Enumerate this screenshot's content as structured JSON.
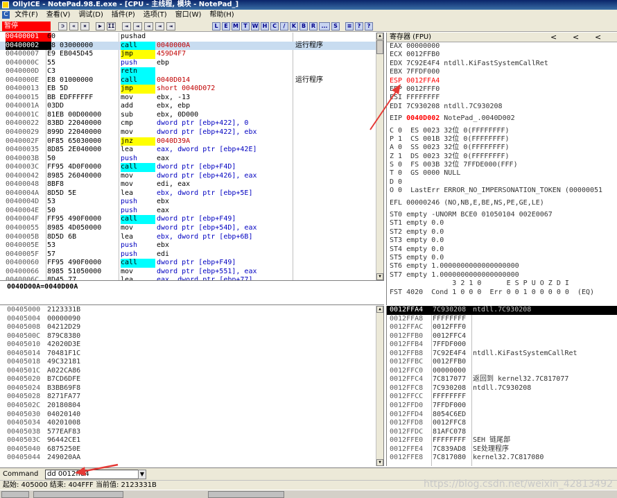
{
  "window": {
    "title": "OllyICE - NotePad.98.E.exe - [CPU - 主线程, 模块 - NotePad_]"
  },
  "menu": [
    "文件(F)",
    "查看(V)",
    "调试(D)",
    "插件(P)",
    "选项(T)",
    "窗口(W)",
    "帮助(H)"
  ],
  "toolbar": {
    "status": "暂停",
    "buttons": [
      "⊃",
      "«",
      "×",
      "▶",
      "II",
      "⇥",
      "⇥",
      "⇥",
      "⇥",
      "⇥"
    ],
    "letters": [
      "L",
      "E",
      "M",
      "T",
      "W",
      "H",
      "C",
      "/",
      "K",
      "B",
      "R",
      "...",
      "S",
      "≡",
      "?",
      "?"
    ]
  },
  "cpu": {
    "rows": [
      {
        "addr": "00400001",
        "hex": "60",
        "mn": "pushad",
        "ops": "",
        "cm": "",
        "addr_red": true
      },
      {
        "addr": "00400002",
        "hex": "E8 03000000",
        "mn": "call",
        "ops": "0040000A",
        "cm": "运行程序",
        "sel": true
      },
      {
        "addr": "00400007",
        "hex": "E9 EB045D45",
        "mn": "jmp",
        "ops": "459D4F7",
        "cm": ""
      },
      {
        "addr": "0040000C",
        "hex": "55",
        "mn": "push",
        "ops": "ebp",
        "cm": ""
      },
      {
        "addr": "0040000D",
        "hex": "C3",
        "mn": "retn",
        "ops": "",
        "cm": ""
      },
      {
        "addr": "0040000E",
        "hex": "E8 01000000",
        "mn": "call",
        "ops": "0040D014",
        "cm": "运行程序"
      },
      {
        "addr": "00400013",
        "hex": "EB 5D",
        "mn": "jmp",
        "ops": "short 0040D072",
        "cm": ""
      },
      {
        "addr": "00400015",
        "hex": "BB EDFFFFFF",
        "mn": "mov",
        "ops": "ebx, -13",
        "cm": ""
      },
      {
        "addr": "0040001A",
        "hex": "03DD",
        "mn": "add",
        "ops": "ebx, ebp",
        "cm": ""
      },
      {
        "addr": "0040001C",
        "hex": "81EB 00D00000",
        "mn": "sub",
        "ops": "ebx, 0D000",
        "cm": ""
      },
      {
        "addr": "00400022",
        "hex": "83BD 22040000",
        "mn": "cmp",
        "ops": "dword ptr [ebp+422], 0",
        "cm": ""
      },
      {
        "addr": "00400029",
        "hex": "899D 22040000",
        "mn": "mov",
        "ops": "dword ptr [ebp+422], ebx",
        "cm": ""
      },
      {
        "addr": "0040002F",
        "hex": "0F85 65030000",
        "mn": "jnz",
        "ops": "0040D39A",
        "cm": ""
      },
      {
        "addr": "00400035",
        "hex": "8D85 2E040000",
        "mn": "lea",
        "ops": "eax, dword ptr [ebp+42E]",
        "cm": ""
      },
      {
        "addr": "0040003B",
        "hex": "50",
        "mn": "push",
        "ops": "eax",
        "cm": ""
      },
      {
        "addr": "0040003C",
        "hex": "FF95 4D0F0000",
        "mn": "call",
        "ops": "dword ptr [ebp+F4D]",
        "cm": ""
      },
      {
        "addr": "00400042",
        "hex": "8985 26040000",
        "mn": "mov",
        "ops": "dword ptr [ebp+426], eax",
        "cm": ""
      },
      {
        "addr": "00400048",
        "hex": "8BF8",
        "mn": "mov",
        "ops": "edi, eax",
        "cm": ""
      },
      {
        "addr": "0040004A",
        "hex": "8D5D 5E",
        "mn": "lea",
        "ops": "ebx, dword ptr [ebp+5E]",
        "cm": ""
      },
      {
        "addr": "0040004D",
        "hex": "53",
        "mn": "push",
        "ops": "ebx",
        "cm": ""
      },
      {
        "addr": "0040004E",
        "hex": "50",
        "mn": "push",
        "ops": "eax",
        "cm": ""
      },
      {
        "addr": "0040004F",
        "hex": "FF95 490F0000",
        "mn": "call",
        "ops": "dword ptr [ebp+F49]",
        "cm": ""
      },
      {
        "addr": "00400055",
        "hex": "8985 4D050000",
        "mn": "mov",
        "ops": "dword ptr [ebp+54D], eax",
        "cm": ""
      },
      {
        "addr": "0040005B",
        "hex": "8D5D 6B",
        "mn": "lea",
        "ops": "ebx, dword ptr [ebp+6B]",
        "cm": ""
      },
      {
        "addr": "0040005E",
        "hex": "53",
        "mn": "push",
        "ops": "ebx",
        "cm": ""
      },
      {
        "addr": "0040005F",
        "hex": "57",
        "mn": "push",
        "ops": "edi",
        "cm": ""
      },
      {
        "addr": "00400060",
        "hex": "FF95 490F0000",
        "mn": "call",
        "ops": "dword ptr [ebp+F49]",
        "cm": ""
      },
      {
        "addr": "00400066",
        "hex": "8985 51050000",
        "mn": "mov",
        "ops": "dword ptr [ebp+551], eax",
        "cm": ""
      },
      {
        "addr": "0040006C",
        "hex": "8D45 77",
        "mn": "lea",
        "ops": "eax, dword ptr [ebp+77]",
        "cm": ""
      }
    ]
  },
  "info": {
    "text": "0040D00A=0040D00A"
  },
  "registers": {
    "header": "寄存器 (FPU)",
    "nav": [
      "<",
      "<",
      "<"
    ],
    "lines": [
      {
        "t": "EAX 00000000"
      },
      {
        "t": "ECX 0012FFB0"
      },
      {
        "t": "EDX 7C92E4F4 ntdll.KiFastSystemCallRet"
      },
      {
        "t": "EBX 7FFDF000"
      },
      {
        "t": "ESP 0012FFA4",
        "red": true
      },
      {
        "t": "EBP 0012FFF0"
      },
      {
        "t": "ESI FFFFFFFF"
      },
      {
        "t": "EDI 7C930208 ntdll.7C930208"
      },
      {
        "gap": true
      },
      {
        "t": "EIP 0040D002 NotePad_.0040D002",
        "eip": true
      },
      {
        "gap": true
      },
      {
        "t": "C 0  ES 0023 32位 0(FFFFFFFF)"
      },
      {
        "t": "P 1  CS 001B 32位 0(FFFFFFFF)"
      },
      {
        "t": "A 0  SS 0023 32位 0(FFFFFFFF)"
      },
      {
        "t": "Z 1  DS 0023 32位 0(FFFFFFFF)"
      },
      {
        "t": "S 0  FS 003B 32位 7FFDE000(FFF)"
      },
      {
        "t": "T 0  GS 0000 NULL"
      },
      {
        "t": "D 0"
      },
      {
        "t": "O 0  LastErr ERROR_NO_IMPERSONATION_TOKEN (00000051"
      },
      {
        "gap": true
      },
      {
        "t": "EFL 00000246 (NO,NB,E,BE,NS,PE,GE,LE)"
      },
      {
        "gap": true
      },
      {
        "t": "ST0 empty -UNORM BCE0 01050104 002E0067"
      },
      {
        "t": "ST1 empty 0.0"
      },
      {
        "t": "ST2 empty 0.0"
      },
      {
        "t": "ST3 empty 0.0"
      },
      {
        "t": "ST4 empty 0.0"
      },
      {
        "t": "ST5 empty 0.0"
      },
      {
        "t": "ST6 empty 1.0000000000000000000"
      },
      {
        "t": "ST7 empty 1.0000000000000000000"
      },
      {
        "t": "               3 2 1 0      E S P U O Z D I"
      },
      {
        "t": "FST 4020  Cond 1 0 0 0  Err 0 0 1 0 0 0 0 0  (EQ)"
      }
    ]
  },
  "dump": {
    "rows": [
      {
        "addr": "00405000",
        "val": "2123331B"
      },
      {
        "addr": "00405004",
        "val": "00000090"
      },
      {
        "addr": "00405008",
        "val": "04212D29"
      },
      {
        "addr": "0040500C",
        "val": "879C8380"
      },
      {
        "addr": "00405010",
        "val": "42020D3E"
      },
      {
        "addr": "00405014",
        "val": "70481F1C"
      },
      {
        "addr": "00405018",
        "val": "49C32181"
      },
      {
        "addr": "0040501C",
        "val": "A022CA86"
      },
      {
        "addr": "00405020",
        "val": "B7CD6DFE"
      },
      {
        "addr": "00405024",
        "val": "B3BB69F8"
      },
      {
        "addr": "00405028",
        "val": "8271FA77"
      },
      {
        "addr": "0040502C",
        "val": "20180804"
      },
      {
        "addr": "00405030",
        "val": "04020140"
      },
      {
        "addr": "00405034",
        "val": "40201008"
      },
      {
        "addr": "00405038",
        "val": "577EAF83"
      },
      {
        "addr": "0040503C",
        "val": "96442CE1"
      },
      {
        "addr": "00405040",
        "val": "6875250E"
      },
      {
        "addr": "00405044",
        "val": "249020AA"
      }
    ]
  },
  "stack": {
    "rows": [
      {
        "addr": "0012FFA4",
        "val": "7C930208",
        "cm": "ntdll.7C930208",
        "sel": true
      },
      {
        "addr": "0012FFA8",
        "val": "FFFFFFFF",
        "cm": ""
      },
      {
        "addr": "0012FFAC",
        "val": "0012FFF0",
        "cm": ""
      },
      {
        "addr": "0012FFB0",
        "val": "0012FFC4",
        "cm": ""
      },
      {
        "addr": "0012FFB4",
        "val": "7FFDF000",
        "cm": ""
      },
      {
        "addr": "0012FFB8",
        "val": "7C92E4F4",
        "cm": "ntdll.KiFastSystemCallRet"
      },
      {
        "addr": "0012FFBC",
        "val": "0012FFB0",
        "cm": ""
      },
      {
        "addr": "0012FFC0",
        "val": "00000000",
        "cm": ""
      },
      {
        "addr": "0012FFC4",
        "val": "7C817077",
        "cm": "返回到 kernel32.7C817077"
      },
      {
        "addr": "0012FFC8",
        "val": "7C930208",
        "cm": "ntdll.7C930208"
      },
      {
        "addr": "0012FFCC",
        "val": "FFFFFFFF",
        "cm": ""
      },
      {
        "addr": "0012FFD0",
        "val": "7FFDF000",
        "cm": ""
      },
      {
        "addr": "0012FFD4",
        "val": "8054C6ED",
        "cm": ""
      },
      {
        "addr": "0012FFD8",
        "val": "0012FFC8",
        "cm": ""
      },
      {
        "addr": "0012FFDC",
        "val": "81AFC078",
        "cm": ""
      },
      {
        "addr": "0012FFE0",
        "val": "FFFFFFFF",
        "cm": "SEH 链尾部"
      },
      {
        "addr": "0012FFE4",
        "val": "7C839AD8",
        "cm": "SE处理程序"
      },
      {
        "addr": "0012FFE8",
        "val": "7C817080",
        "cm": "kernel32.7C817080"
      }
    ]
  },
  "command": {
    "label": "Command",
    "value": "dd 0012ffa4",
    "dropdown": "▼"
  },
  "status": {
    "text": "起始: 405000 结束: 404FFF 当前值: 2123331B"
  },
  "watermark": "https://blog.csdn.net/weixin_42813492",
  "colors": {
    "accent_red": "#ff0000",
    "highlight_cyan": "#00ffff",
    "highlight_yellow": "#ffff00",
    "arrow_red": "#e53935"
  }
}
